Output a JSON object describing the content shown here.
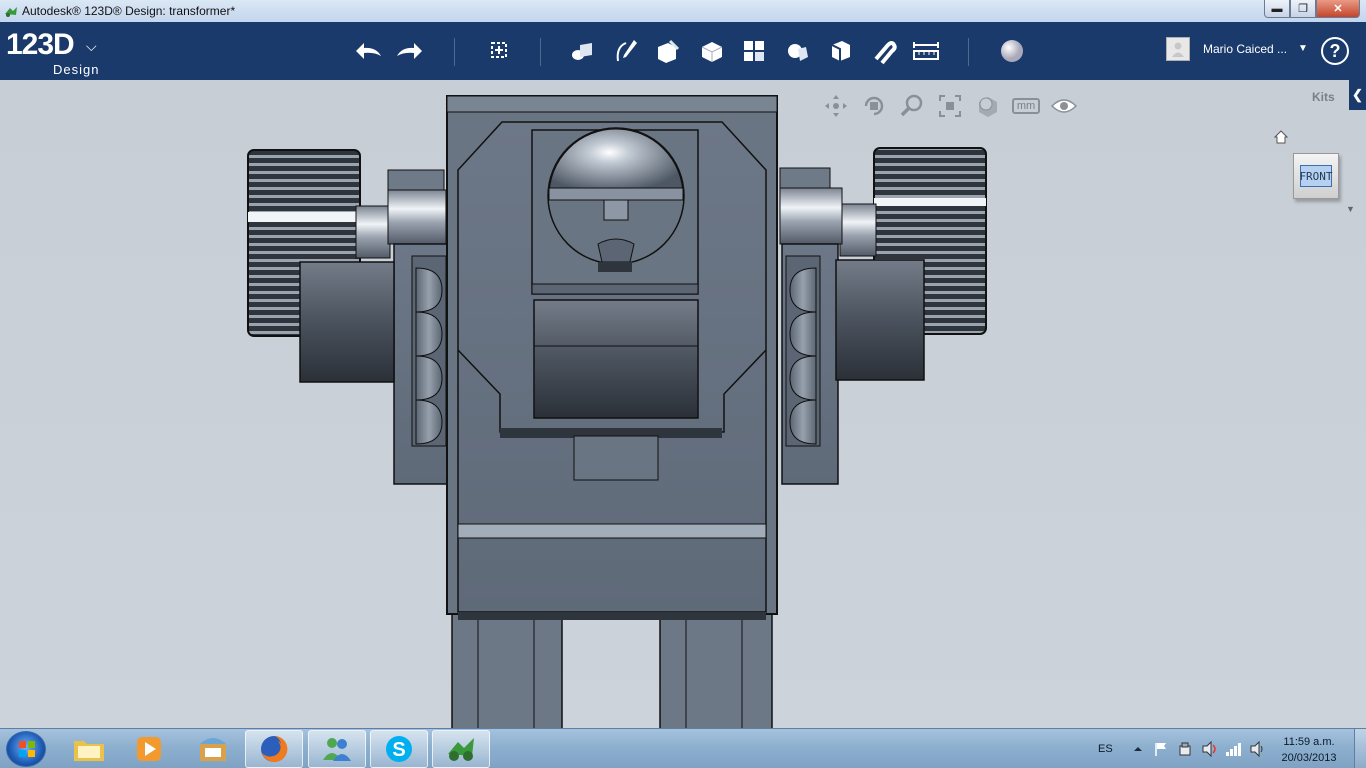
{
  "window": {
    "title": "Autodesk® 123D® Design: transformer*",
    "min_label": "▬",
    "max_label": "❐",
    "close_label": "✕"
  },
  "logo": {
    "main": "123D",
    "sub": "Design"
  },
  "toolbar": {
    "tools": [
      "undo-icon",
      "redo-icon",
      "transform-icon",
      "primitives-icon",
      "sketch-icon",
      "construct-icon",
      "modify-icon",
      "pattern-icon",
      "grouping-icon",
      "combine-icon",
      "snap-icon",
      "measure-icon",
      "material-icon"
    ]
  },
  "user": {
    "name": "Mario Caiced ..."
  },
  "help": {
    "label": "?"
  },
  "navbar": {
    "units": "mm"
  },
  "kits": {
    "label": "Kits",
    "tab": "❮"
  },
  "viewcube": {
    "face_label": "FRONT"
  },
  "taskbar": {
    "apps": [
      "windows-explorer-icon",
      "media-player-icon",
      "app-store-icon",
      "firefox-icon",
      "messenger-icon",
      "skype-icon",
      "123d-design-icon"
    ],
    "language": "ES",
    "time": "11:59 a.m.",
    "date": "20/03/2013"
  }
}
